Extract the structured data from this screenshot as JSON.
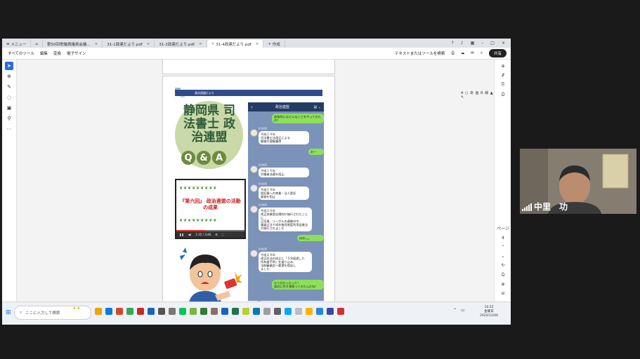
{
  "acrobat": {
    "tabs": [
      {
        "label": "メニュー"
      },
      {
        "label": "第50回常議員議員会議..."
      },
      {
        "label": "31-1政連だより.pdf"
      },
      {
        "label": "31-2政連だより.pdf"
      },
      {
        "label": "31-4政連だより.pdf"
      },
      {
        "label": "作成"
      }
    ],
    "toolbar": {
      "menus": [
        "すべてのツール",
        "編集",
        "変換",
        "電子サイン"
      ],
      "search_placeholder": "テキストまたはツールを検索",
      "share_label": "共有"
    },
    "annotation_tools": "A ○ あ 画 R 線 ▲ ✎"
  },
  "document": {
    "header_label": "政治連盟だより",
    "title": "静岡県 司法書士 政治連盟",
    "qa_letters": [
      "Q",
      "&",
      "A"
    ],
    "video": {
      "title": "『第六回』 政治連盟の活動の成果",
      "time": "1:35 / 3:46",
      "progress": 0.42
    },
    "phone": {
      "header": "政治連盟",
      "messages": [
        {
          "side": "right",
          "text": "具体的にはどんなことをやってきたの？"
        },
        {
          "side": "left",
          "sender": "政治連盟",
          "text": "平成１４年\n司法書士法改正による\n簡裁代理権獲得"
        },
        {
          "side": "right",
          "text": "おー"
        },
        {
          "side": "left",
          "sender": "政治連盟",
          "text": "平成１６年\n労働者派遣を阻止"
        },
        {
          "side": "left",
          "sender": "政治連盟",
          "text": "平成１９年\n登記業への商業・法人登記\n調査を阻止"
        },
        {
          "side": "left",
          "sender": "政治連盟",
          "text": "平成２８年\n改正商業登記規則が施行されたことに、\n日司連、リーガルの連携の中、\n議員立法で成年後見制度利用促進法\nが施行されました"
        },
        {
          "side": "right",
          "text": "ほお。。。"
        },
        {
          "side": "left",
          "sender": "政治連盟",
          "text": "平成２９年\n改正民法の成立に「５年経過した\n所有者不明」を盛り込み、\n法制審議会へ要望を提出し\nました"
        },
        {
          "side": "right",
          "text": "もう分かったって！\n身近に色々頑張ってきたんだね！"
        }
      ]
    }
  },
  "right_tools": [
    "⊕",
    "⇵",
    "⎘",
    "⎙",
    "ページ",
    "4",
    "⌃",
    "⌄",
    "↻",
    "⎙",
    "⊕",
    "⊖"
  ],
  "taskbar": {
    "search_placeholder": "ここに入力して検索",
    "clock_time": "16:55",
    "clock_day": "金曜日",
    "clock_date": "2024/12/06"
  },
  "participant": {
    "name": "中里　功"
  },
  "colors": {
    "accent": "#2d6cdf",
    "phone_bg": "#7b92b9",
    "phone_header": "#243b63",
    "bubble_green": "#8ee05b"
  }
}
